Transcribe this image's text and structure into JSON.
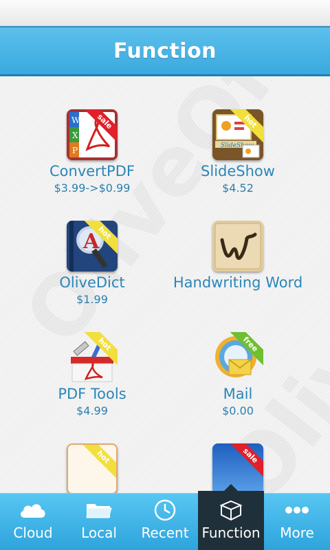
{
  "header": {
    "title": "Function"
  },
  "watermark": "OliveOffice",
  "apps": [
    {
      "name": "ConvertPDF",
      "price": "$3.99->$0.99",
      "badge": "sale",
      "icon": "convertpdf-icon"
    },
    {
      "name": "SlideShow",
      "price": "$4.52",
      "badge": "hot",
      "icon": "slideshow-icon"
    },
    {
      "name": "OliveDict",
      "price": "$1.99",
      "badge": "hot",
      "icon": "dictionary-icon"
    },
    {
      "name": "Handwriting Word",
      "price": "",
      "badge": "",
      "icon": "handwriting-icon"
    },
    {
      "name": "PDF Tools",
      "price": "$4.99",
      "badge": "hot",
      "icon": "pdf-tools-icon"
    },
    {
      "name": "Mail",
      "price": "$0.00",
      "badge": "free",
      "icon": "mail-icon"
    },
    {
      "name": "",
      "price": "",
      "badge": "hot",
      "icon": "notes-icon"
    },
    {
      "name": "",
      "price": "",
      "badge": "sale",
      "icon": "windows-icon"
    }
  ],
  "tabs": [
    {
      "label": "Cloud",
      "icon": "cloud-icon",
      "active": false
    },
    {
      "label": "Local",
      "icon": "folder-icon",
      "active": false
    },
    {
      "label": "Recent",
      "icon": "clock-icon",
      "active": false
    },
    {
      "label": "Function",
      "icon": "box-icon",
      "active": true
    },
    {
      "label": "More",
      "icon": "more-dots-icon",
      "active": false
    }
  ],
  "colors": {
    "accent": "#3aa9df",
    "text": "#2a86b8",
    "active_tab": "#20303b"
  }
}
